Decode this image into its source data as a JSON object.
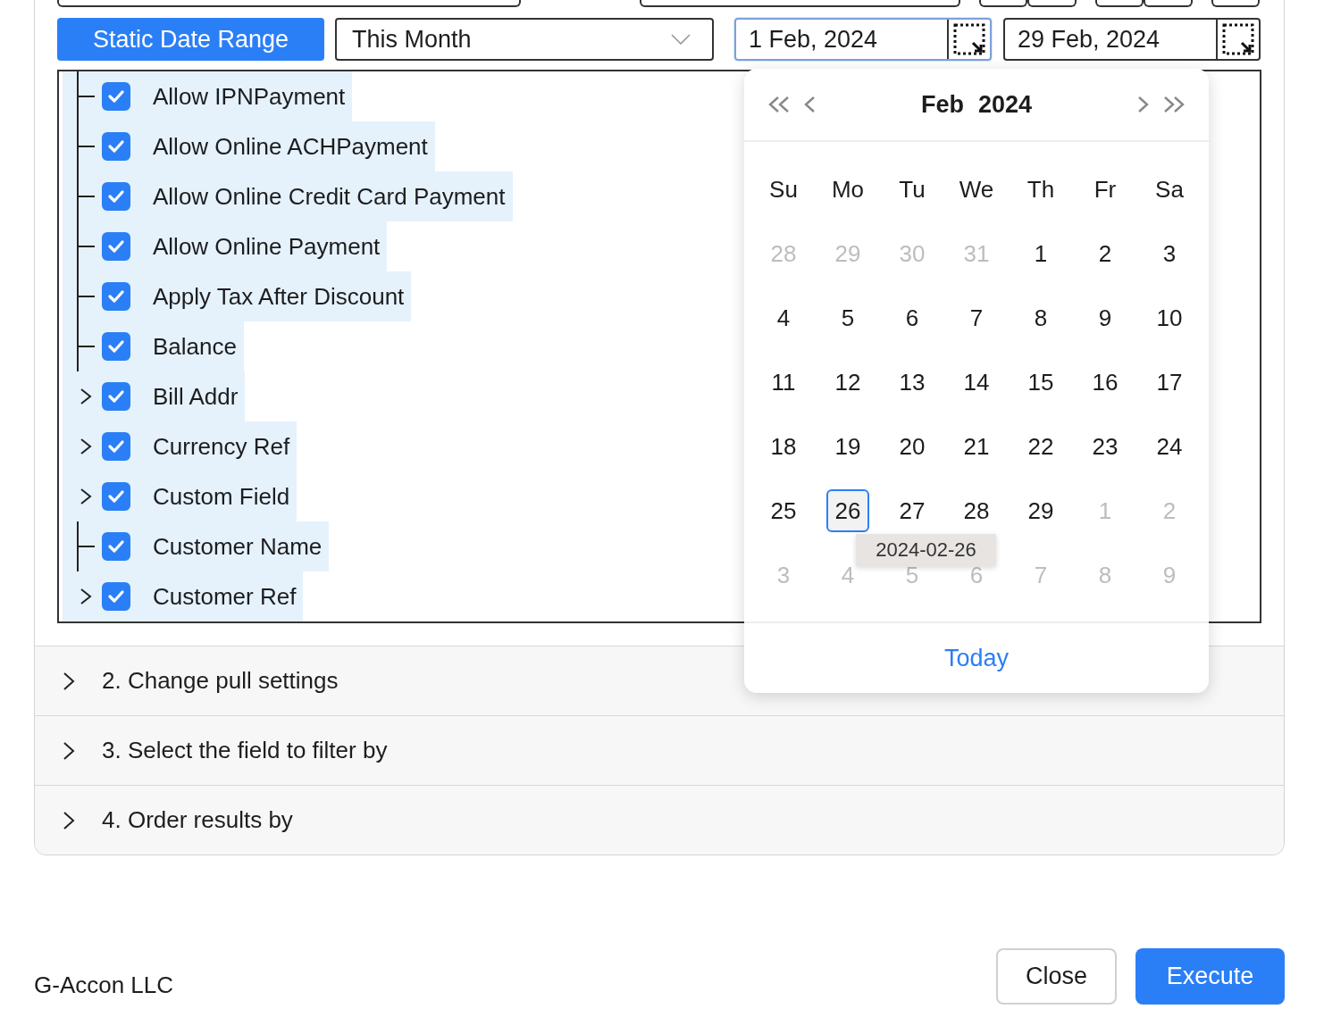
{
  "date_range": {
    "mode_button": "Static Date Range",
    "period": {
      "value": "This Month"
    },
    "start": {
      "value": "1 Feb, 2024",
      "focused": true
    },
    "end": {
      "value": "29 Feb, 2024",
      "focused": false
    }
  },
  "fields": [
    {
      "label": "Allow IPNPayment",
      "checked": true,
      "kind": "leaf"
    },
    {
      "label": "Allow Online ACHPayment",
      "checked": true,
      "kind": "leaf"
    },
    {
      "label": "Allow Online Credit Card Payment",
      "checked": true,
      "kind": "leaf"
    },
    {
      "label": "Allow Online Payment",
      "checked": true,
      "kind": "leaf"
    },
    {
      "label": "Apply Tax After Discount",
      "checked": true,
      "kind": "leaf"
    },
    {
      "label": "Balance",
      "checked": true,
      "kind": "leaf"
    },
    {
      "label": "Bill Addr",
      "checked": true,
      "kind": "branch"
    },
    {
      "label": "Currency Ref",
      "checked": true,
      "kind": "branch"
    },
    {
      "label": "Custom Field",
      "checked": true,
      "kind": "branch"
    },
    {
      "label": "Customer Name",
      "checked": true,
      "kind": "leaf"
    },
    {
      "label": "Customer Ref",
      "checked": true,
      "kind": "branch"
    }
  ],
  "calendar": {
    "month": "Feb",
    "year": "2024",
    "weekdays": [
      "Su",
      "Mo",
      "Tu",
      "We",
      "Th",
      "Fr",
      "Sa"
    ],
    "weeks": [
      [
        {
          "day": "28",
          "outside": true,
          "selected": false
        },
        {
          "day": "29",
          "outside": true,
          "selected": false
        },
        {
          "day": "30",
          "outside": true,
          "selected": false
        },
        {
          "day": "31",
          "outside": true,
          "selected": false
        },
        {
          "day": "1",
          "outside": false,
          "selected": false
        },
        {
          "day": "2",
          "outside": false,
          "selected": false
        },
        {
          "day": "3",
          "outside": false,
          "selected": false
        }
      ],
      [
        {
          "day": "4",
          "outside": false,
          "selected": false
        },
        {
          "day": "5",
          "outside": false,
          "selected": false
        },
        {
          "day": "6",
          "outside": false,
          "selected": false
        },
        {
          "day": "7",
          "outside": false,
          "selected": false
        },
        {
          "day": "8",
          "outside": false,
          "selected": false
        },
        {
          "day": "9",
          "outside": false,
          "selected": false
        },
        {
          "day": "10",
          "outside": false,
          "selected": false
        }
      ],
      [
        {
          "day": "11",
          "outside": false,
          "selected": false
        },
        {
          "day": "12",
          "outside": false,
          "selected": false
        },
        {
          "day": "13",
          "outside": false,
          "selected": false
        },
        {
          "day": "14",
          "outside": false,
          "selected": false
        },
        {
          "day": "15",
          "outside": false,
          "selected": false
        },
        {
          "day": "16",
          "outside": false,
          "selected": false
        },
        {
          "day": "17",
          "outside": false,
          "selected": false
        }
      ],
      [
        {
          "day": "18",
          "outside": false,
          "selected": false
        },
        {
          "day": "19",
          "outside": false,
          "selected": false
        },
        {
          "day": "20",
          "outside": false,
          "selected": false
        },
        {
          "day": "21",
          "outside": false,
          "selected": false
        },
        {
          "day": "22",
          "outside": false,
          "selected": false
        },
        {
          "day": "23",
          "outside": false,
          "selected": false
        },
        {
          "day": "24",
          "outside": false,
          "selected": false
        }
      ],
      [
        {
          "day": "25",
          "outside": false,
          "selected": false
        },
        {
          "day": "26",
          "outside": false,
          "selected": true
        },
        {
          "day": "27",
          "outside": false,
          "selected": false
        },
        {
          "day": "28",
          "outside": false,
          "selected": false
        },
        {
          "day": "29",
          "outside": false,
          "selected": false
        },
        {
          "day": "1",
          "outside": true,
          "selected": false
        },
        {
          "day": "2",
          "outside": true,
          "selected": false
        }
      ],
      [
        {
          "day": "3",
          "outside": true,
          "selected": false
        },
        {
          "day": "4",
          "outside": true,
          "selected": false
        },
        {
          "day": "5",
          "outside": true,
          "selected": false
        },
        {
          "day": "6",
          "outside": true,
          "selected": false
        },
        {
          "day": "7",
          "outside": true,
          "selected": false
        },
        {
          "day": "8",
          "outside": true,
          "selected": false
        },
        {
          "day": "9",
          "outside": true,
          "selected": false
        }
      ]
    ],
    "tooltip": "2024-02-26",
    "today": "Today"
  },
  "sections": [
    {
      "label": "2. Change pull settings",
      "expanded": false
    },
    {
      "label": "3. Select the field to filter by",
      "expanded": false
    },
    {
      "label": "4. Order results by",
      "expanded": false
    }
  ],
  "footer": {
    "company": "G-Accon LLC",
    "buttons": [
      {
        "label": "Close",
        "kind": "secondary"
      },
      {
        "label": "Execute",
        "kind": "primary"
      }
    ]
  }
}
